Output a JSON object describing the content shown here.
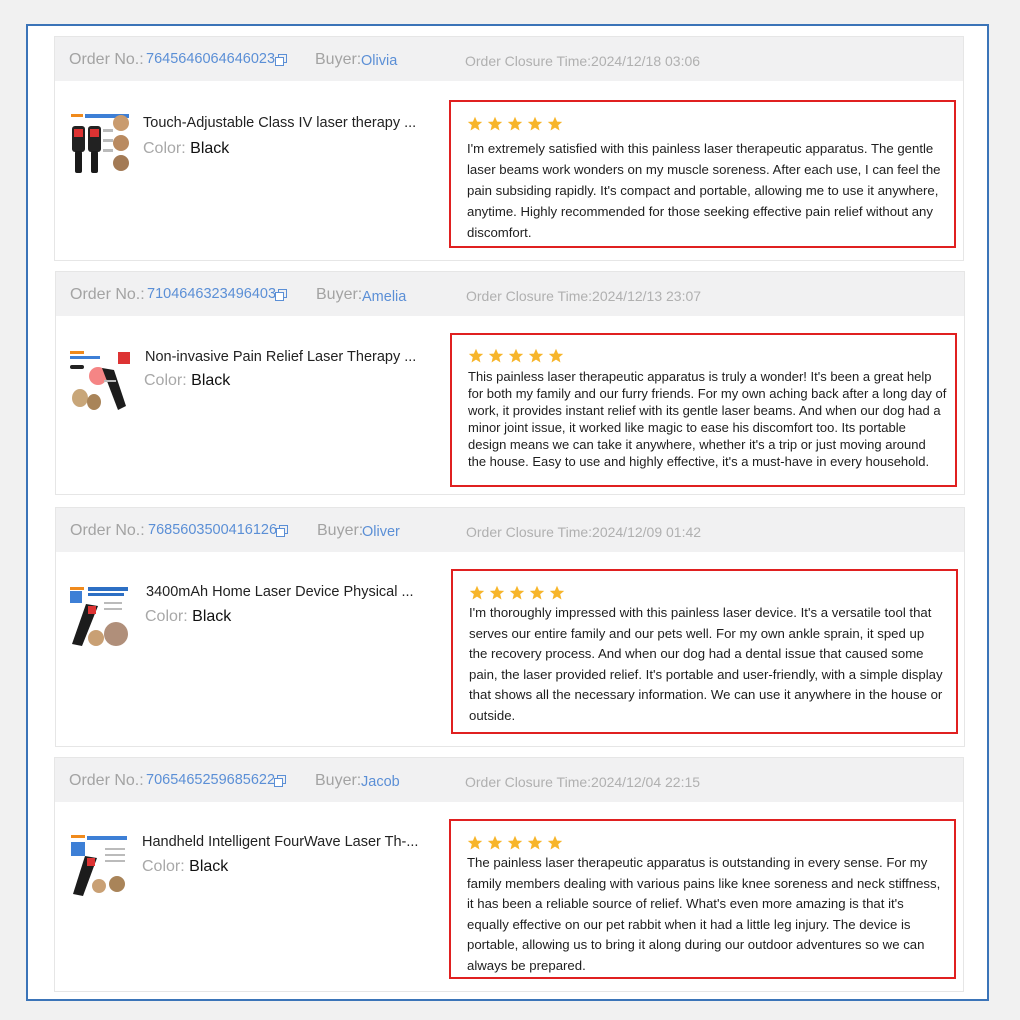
{
  "labels": {
    "order_no": "Order No.:",
    "buyer": "Buyer:",
    "color": "Color:"
  },
  "colors": {
    "accent_blue": "#5b8fd6",
    "frame_blue": "#3b74b8",
    "review_border_red": "#e02020",
    "star_yellow": "#f7b52a"
  },
  "icons": {
    "copy": "copy-icon",
    "star": "star-icon"
  },
  "orders": [
    {
      "order_number": "7645646064646023",
      "buyer_name": "Olivia",
      "closure_time": "Order Closure Time:2024/12/18 03:06",
      "product_name": "Touch-Adjustable Class IV laser therapy ...",
      "color_value": "Black",
      "rating": 5,
      "review": "I'm extremely satisfied with this painless laser therapeutic apparatus. The gentle laser beams work wonders on my muscle soreness. After each use, I can feel the pain subsiding rapidly. It's compact and portable, allowing me to use it anywhere, anytime. Highly recommended for those seeking effective pain relief without any discomfort."
    },
    {
      "order_number": "7104646323496403",
      "buyer_name": "Amelia",
      "closure_time": "Order Closure Time:2024/12/13 23:07",
      "product_name": "Non-invasive Pain Relief Laser Therapy ...",
      "color_value": "Black",
      "rating": 5,
      "review": "This painless laser therapeutic apparatus is truly a wonder! It's been a great help for both my family and our furry friends. For my own aching back after a long day of work, it provides instant relief with its gentle laser beams. And when our dog had a minor joint issue, it worked like magic to ease his discomfort too. Its portable design means we can take it anywhere, whether it's a trip or just moving around the house. Easy to use and highly effective, it's a must-have in every household."
    },
    {
      "order_number": "7685603500416126",
      "buyer_name": "Oliver",
      "closure_time": "Order Closure Time:2024/12/09 01:42",
      "product_name": "3400mAh Home Laser Device Physical ...",
      "color_value": "Black",
      "rating": 5,
      "review": "I'm thoroughly impressed with this painless laser device. It's a versatile tool that serves our entire family and our pets well. For my own ankle sprain, it sped up the recovery process. And when our dog had a dental issue that caused some pain, the laser provided relief. It's portable and user-friendly, with a simple display that shows all the necessary information. We can use it anywhere in the house or outside."
    },
    {
      "order_number": "7065465259685622",
      "buyer_name": "Jacob",
      "closure_time": "Order Closure Time:2024/12/04 22:15",
      "product_name": "Handheld Intelligent FourWave Laser Th-...",
      "color_value": "Black",
      "rating": 5,
      "review": "The painless laser therapeutic apparatus is outstanding in every sense. For my family members dealing with various pains like knee soreness and neck stiffness, it has been a reliable source of relief. What's even more amazing is that it's equally effective on our pet rabbit when it had a little leg injury. The device is portable, allowing us to bring it along during our outdoor adventures so we can always be prepared."
    }
  ]
}
